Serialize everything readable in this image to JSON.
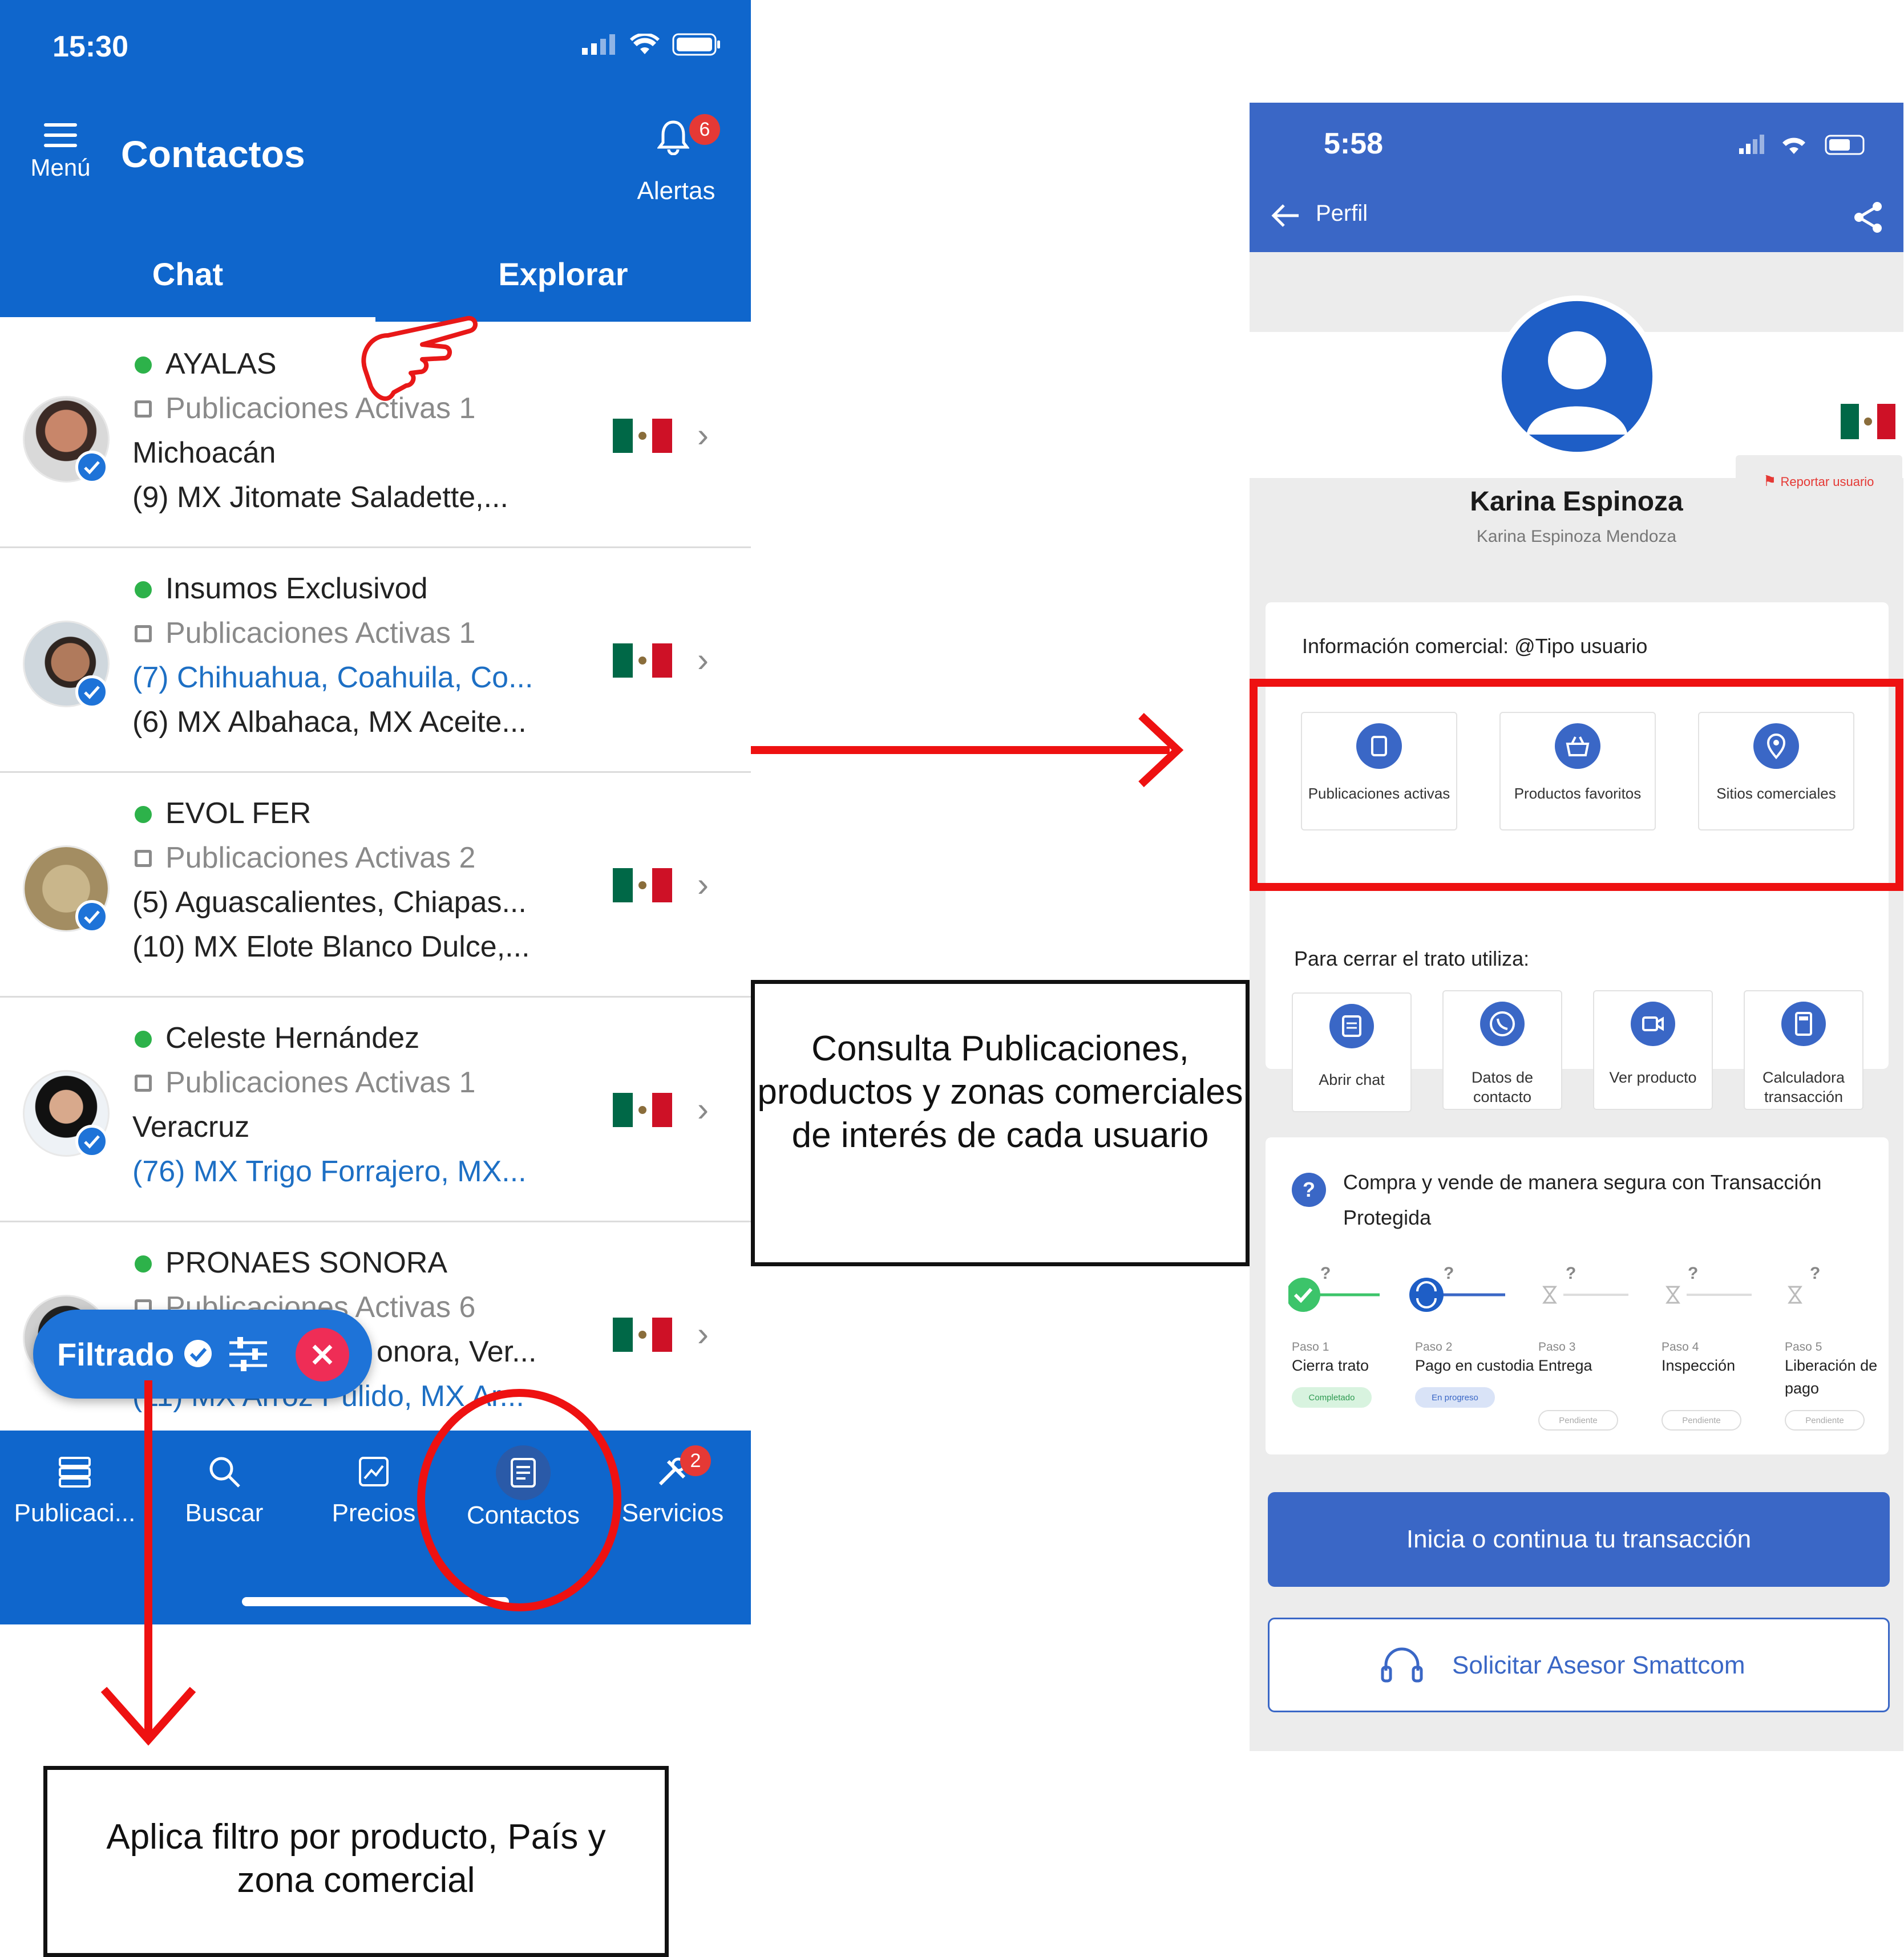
{
  "left_phone": {
    "status_time": "15:30",
    "menu_label": "Menú",
    "title": "Contactos",
    "alerts_label": "Alertas",
    "alerts_count": "6",
    "tabs": [
      "Chat",
      "Explorar"
    ],
    "contacts": [
      {
        "name": "AYALAS",
        "publications": "Publicaciones Activas 1",
        "line3": "Michoacán",
        "line4": "(9) MX Jitomate Saladette,..."
      },
      {
        "name": "Insumos Exclusivod",
        "publications": "Publicaciones Activas 1",
        "line3": "(7) Chihuahua, Coahuila, Co...",
        "line4": "(6) MX Albahaca, MX Aceite..."
      },
      {
        "name": "EVOL FER",
        "publications": "Publicaciones Activas 2",
        "line3": "(5) Aguascalientes, Chiapas...",
        "line4": "(10) MX Elote Blanco Dulce,..."
      },
      {
        "name": "Celeste Hernández",
        "publications": "Publicaciones Activas 1",
        "line3": "Veracruz",
        "line4": "(76) MX Trigo Forrajero, MX..."
      },
      {
        "name": "PRONAES SONORA",
        "publications": "Publicaciones Activas 6",
        "line3": "onora, Ver...",
        "line4": "(11) MX Arroz Pulido, MX Ar..."
      }
    ],
    "filter_label": "Filtrado",
    "nav": [
      {
        "label": "Publicaci...",
        "icon": "publications-icon"
      },
      {
        "label": "Buscar",
        "icon": "search-icon"
      },
      {
        "label": "Precios",
        "icon": "prices-icon"
      },
      {
        "label": "Contactos",
        "icon": "contacts-icon"
      },
      {
        "label": "Servicios",
        "icon": "tools-icon",
        "badge": "2"
      }
    ]
  },
  "right_phone": {
    "status_time": "5:58",
    "back_label": "Perfil",
    "profile_name": "Karina Espinoza",
    "profile_fullname": "Karina Espinoza Mendoza",
    "report_label": "Reportar usuario",
    "commercial_info_title": "Información comercial: @Tipo usuario",
    "commercial_tiles": [
      "Publicaciones activas",
      "Productos favoritos",
      "Sitios comerciales"
    ],
    "close_deal_title": "Para cerrar el trato utiliza:",
    "deal_tiles": [
      "Abrir chat",
      "Datos de contacto",
      "Ver producto",
      "Calculadora transacción"
    ],
    "protected_title": "Compra y vende de manera segura con Transacción Protegida",
    "steps": [
      {
        "step": "Paso 1",
        "name": "Cierra trato",
        "status": "Completado"
      },
      {
        "step": "Paso 2",
        "name": "Pago en custodia",
        "status": "En progreso"
      },
      {
        "step": "Paso 3",
        "name": "Entrega",
        "status": "Pendiente"
      },
      {
        "step": "Paso 4",
        "name": "Inspección",
        "status": "Pendiente"
      },
      {
        "step": "Paso 5",
        "name": "Liberación de pago",
        "status": "Pendiente"
      }
    ],
    "cta_primary": "Inicia o continua tu transacción",
    "cta_secondary": "Solicitar Asesor Smattcom"
  },
  "annotations": {
    "middle_note": "Consulta Publicaciones, productos y zonas comerciales de interés de cada usuario",
    "bottom_note": "Aplica filtro por producto, País y zona comercial"
  },
  "colors": {
    "app_blue": "#0f66cc",
    "profile_blue": "#3a67c6",
    "annotation_red": "#ee1111"
  }
}
